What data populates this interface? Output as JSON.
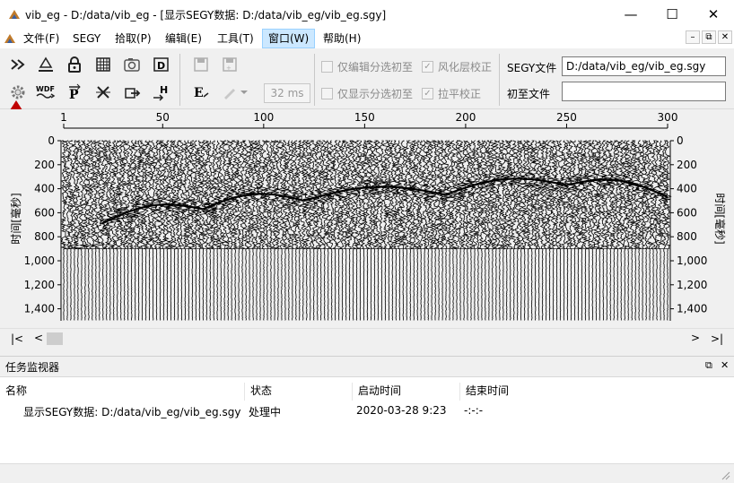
{
  "window": {
    "title": "vib_eg - D:/data/vib_eg - [显示SEGY数据: D:/data/vib_eg/vib_eg.sgy]",
    "minimize": "—",
    "maximize": "☐",
    "close": "✕"
  },
  "menu": [
    {
      "label": "文件(F)"
    },
    {
      "label": "SEGY"
    },
    {
      "label": "拾取(P)"
    },
    {
      "label": "编辑(E)"
    },
    {
      "label": "工具(T)"
    },
    {
      "label": "窗口(W)"
    },
    {
      "label": "帮助(H)"
    }
  ],
  "mdi": {
    "minimize": "–",
    "restore": "⧉",
    "close": "✕"
  },
  "toolbar": {
    "wdf_label": "WDF",
    "ms_value": "32 ms",
    "checkboxes": [
      {
        "label": "仅编辑分选初至",
        "checked": false
      },
      {
        "label": "风化层校正",
        "checked": true
      },
      {
        "label": "仅显示分选初至",
        "checked": false
      },
      {
        "label": "拉平校正",
        "checked": true
      }
    ],
    "segy_label": "SEGY文件",
    "segy_value": "D:/data/vib_eg/vib_eg.sgy",
    "first_label": "初至文件",
    "first_value": ""
  },
  "plot": {
    "ylabel": "时间[毫秒]",
    "x_ticks": [
      "1",
      "50",
      "100",
      "150",
      "200",
      "250",
      "300"
    ],
    "y_ticks": [
      "0",
      "200",
      "400",
      "600",
      "800",
      "1,000",
      "1,200",
      "1,400"
    ],
    "trace_range": [
      1,
      300
    ],
    "time_range_ms": [
      0,
      1500
    ]
  },
  "scroll": {
    "first": "|<",
    "prev": "<",
    "next": ">",
    "last": ">|"
  },
  "monitor": {
    "title": "任务监视器",
    "restore": "⧉",
    "close": "✕",
    "columns": [
      "名称",
      "状态",
      "启动时间",
      "结束时间"
    ],
    "rows": [
      {
        "name": "显示SEGY数据: D:/data/vib_eg/vib_eg.sgy",
        "status": "处理中",
        "start": "2020-03-28 9:23",
        "end": "-:-:-"
      }
    ]
  },
  "colors": {
    "arrow": "#c00000",
    "menu_active": "#cce8ff"
  }
}
